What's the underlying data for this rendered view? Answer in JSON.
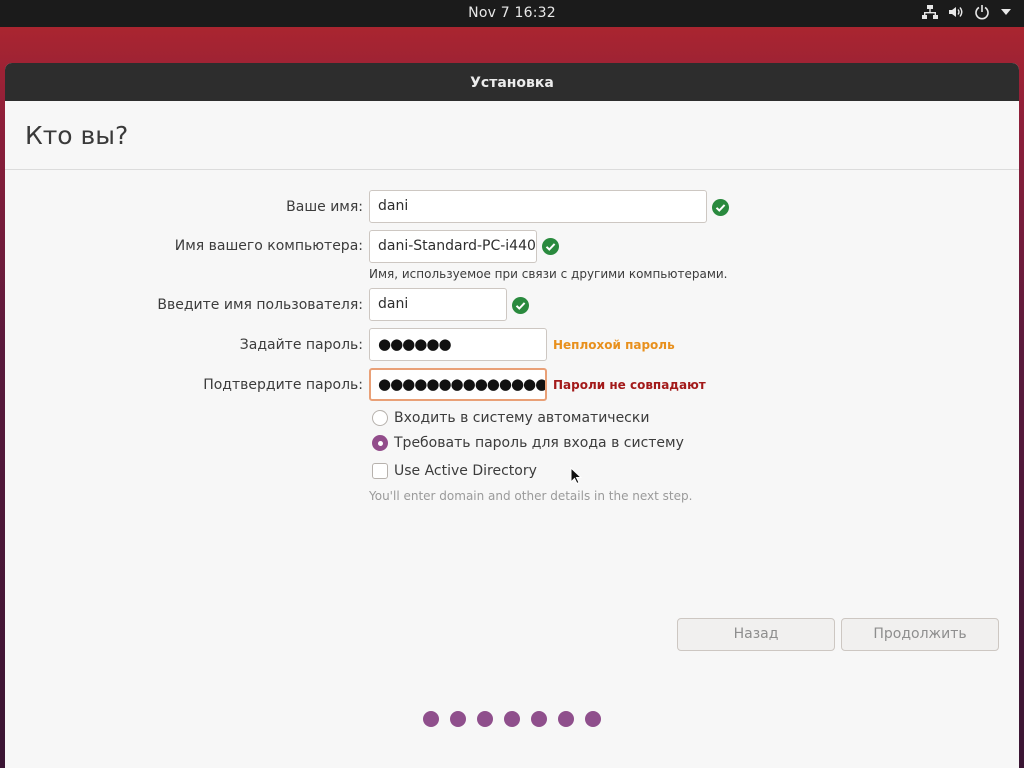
{
  "topbar": {
    "clock": "Nov 7  16:32"
  },
  "window": {
    "title": "Установка"
  },
  "page": {
    "title": "Кто вы?"
  },
  "form": {
    "name": {
      "label": "Ваше имя:",
      "value": "dani"
    },
    "computer": {
      "label": "Имя вашего компьютера:",
      "value": "dani-Standard-PC-i440",
      "hint": "Имя, используемое при связи с другими компьютерами."
    },
    "username": {
      "label": "Введите имя пользователя:",
      "value": "dani"
    },
    "password": {
      "label": "Задайте пароль:",
      "value": "●●●●●●",
      "strength": "Неплохой пароль",
      "strength_color": "#e8901d"
    },
    "confirm": {
      "label": "Подтвердите пароль:",
      "value": "●●●●●●●●●●●●●●",
      "error": "Пароли не совпадают",
      "error_color": "#a31a1a"
    },
    "auto_login_label": "Входить в систему автоматически",
    "require_password_label": "Требовать пароль для входа в систему",
    "active_directory_label": "Use Active Directory",
    "active_directory_hint": "You'll enter domain and other details in the next step."
  },
  "buttons": {
    "back": "Назад",
    "continue": "Продолжить"
  },
  "progress": {
    "steps": 7
  },
  "colors": {
    "accent": "#924d8b",
    "check": "#2a8a3e"
  }
}
